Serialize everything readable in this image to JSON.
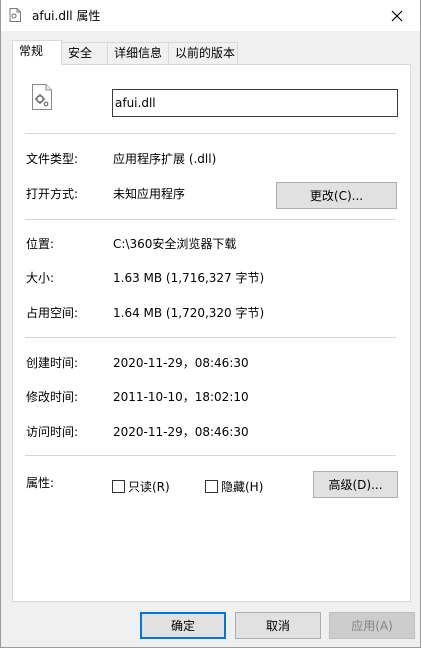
{
  "window": {
    "title": "afui.dll 属性",
    "title_icon": "dll-file-icon",
    "close_icon": "close-icon"
  },
  "tabs": [
    {
      "label": "常规",
      "active": true
    },
    {
      "label": "安全",
      "active": false
    },
    {
      "label": "详细信息",
      "active": false
    },
    {
      "label": "以前的版本",
      "active": false
    }
  ],
  "general": {
    "file_icon": "dll-file-gear-icon",
    "filename": "afui.dll",
    "file_type_label": "文件类型:",
    "file_type_value": "应用程序扩展 (.dll)",
    "open_with_label": "打开方式:",
    "open_with_value": "未知应用程序",
    "change_button": "更改(C)...",
    "location_label": "位置:",
    "location_value": "C:\\360安全浏览器下载",
    "size_label": "大小:",
    "size_value": "1.63 MB (1,716,327 字节)",
    "size_on_disk_label": "占用空间:",
    "size_on_disk_value": "1.64 MB (1,720,320 字节)",
    "created_label": "创建时间:",
    "created_value": "2020-11-29，08:46:30",
    "modified_label": "修改时间:",
    "modified_value": "2011-10-10，18:02:10",
    "accessed_label": "访问时间:",
    "accessed_value": "2020-11-29，08:46:30",
    "attributes_label": "属性:",
    "readonly_label": "只读(R)",
    "readonly_checked": false,
    "hidden_label": "隐藏(H)",
    "hidden_checked": false,
    "advanced_button": "高级(D)..."
  },
  "footer": {
    "ok_button": "确定",
    "cancel_button": "取消",
    "apply_button": "应用(A)"
  },
  "colors": {
    "accent": "#0078d7",
    "window_bg": "#f0f0f0",
    "panel_bg": "#ffffff"
  }
}
